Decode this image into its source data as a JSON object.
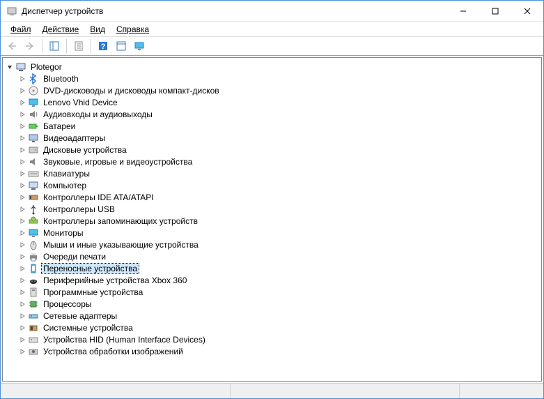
{
  "window": {
    "title": "Диспетчер устройств"
  },
  "menu": {
    "file": "Файл",
    "action": "Действие",
    "view": "Вид",
    "help": "Справка"
  },
  "tree": {
    "root": "Plotegor",
    "items": [
      {
        "label": "Bluetooth",
        "icon": "bluetooth"
      },
      {
        "label": "DVD-дисководы и дисководы компакт-дисков",
        "icon": "dvd"
      },
      {
        "label": "Lenovo Vhid Device",
        "icon": "monitor"
      },
      {
        "label": "Аудиовходы и аудиовыходы",
        "icon": "audio"
      },
      {
        "label": "Батареи",
        "icon": "battery"
      },
      {
        "label": "Видеоадаптеры",
        "icon": "display"
      },
      {
        "label": "Дисковые устройства",
        "icon": "disk"
      },
      {
        "label": "Звуковые, игровые и видеоустройства",
        "icon": "sound"
      },
      {
        "label": "Клавиатуры",
        "icon": "keyboard"
      },
      {
        "label": "Компьютер",
        "icon": "computer"
      },
      {
        "label": "Контроллеры IDE ATA/ATAPI",
        "icon": "ide"
      },
      {
        "label": "Контроллеры USB",
        "icon": "usb"
      },
      {
        "label": "Контроллеры запоминающих устройств",
        "icon": "storage"
      },
      {
        "label": "Мониторы",
        "icon": "monitor2"
      },
      {
        "label": "Мыши и иные указывающие устройства",
        "icon": "mouse"
      },
      {
        "label": "Очереди печати",
        "icon": "printer"
      },
      {
        "label": "Переносные устройства",
        "icon": "portable",
        "selected": true
      },
      {
        "label": "Периферийные устройства Xbox 360",
        "icon": "xbox"
      },
      {
        "label": "Программные устройства",
        "icon": "software"
      },
      {
        "label": "Процессоры",
        "icon": "cpu"
      },
      {
        "label": "Сетевые адаптеры",
        "icon": "network"
      },
      {
        "label": "Системные устройства",
        "icon": "system"
      },
      {
        "label": "Устройства HID (Human Interface Devices)",
        "icon": "hid"
      },
      {
        "label": "Устройства обработки изображений",
        "icon": "imaging"
      }
    ]
  }
}
